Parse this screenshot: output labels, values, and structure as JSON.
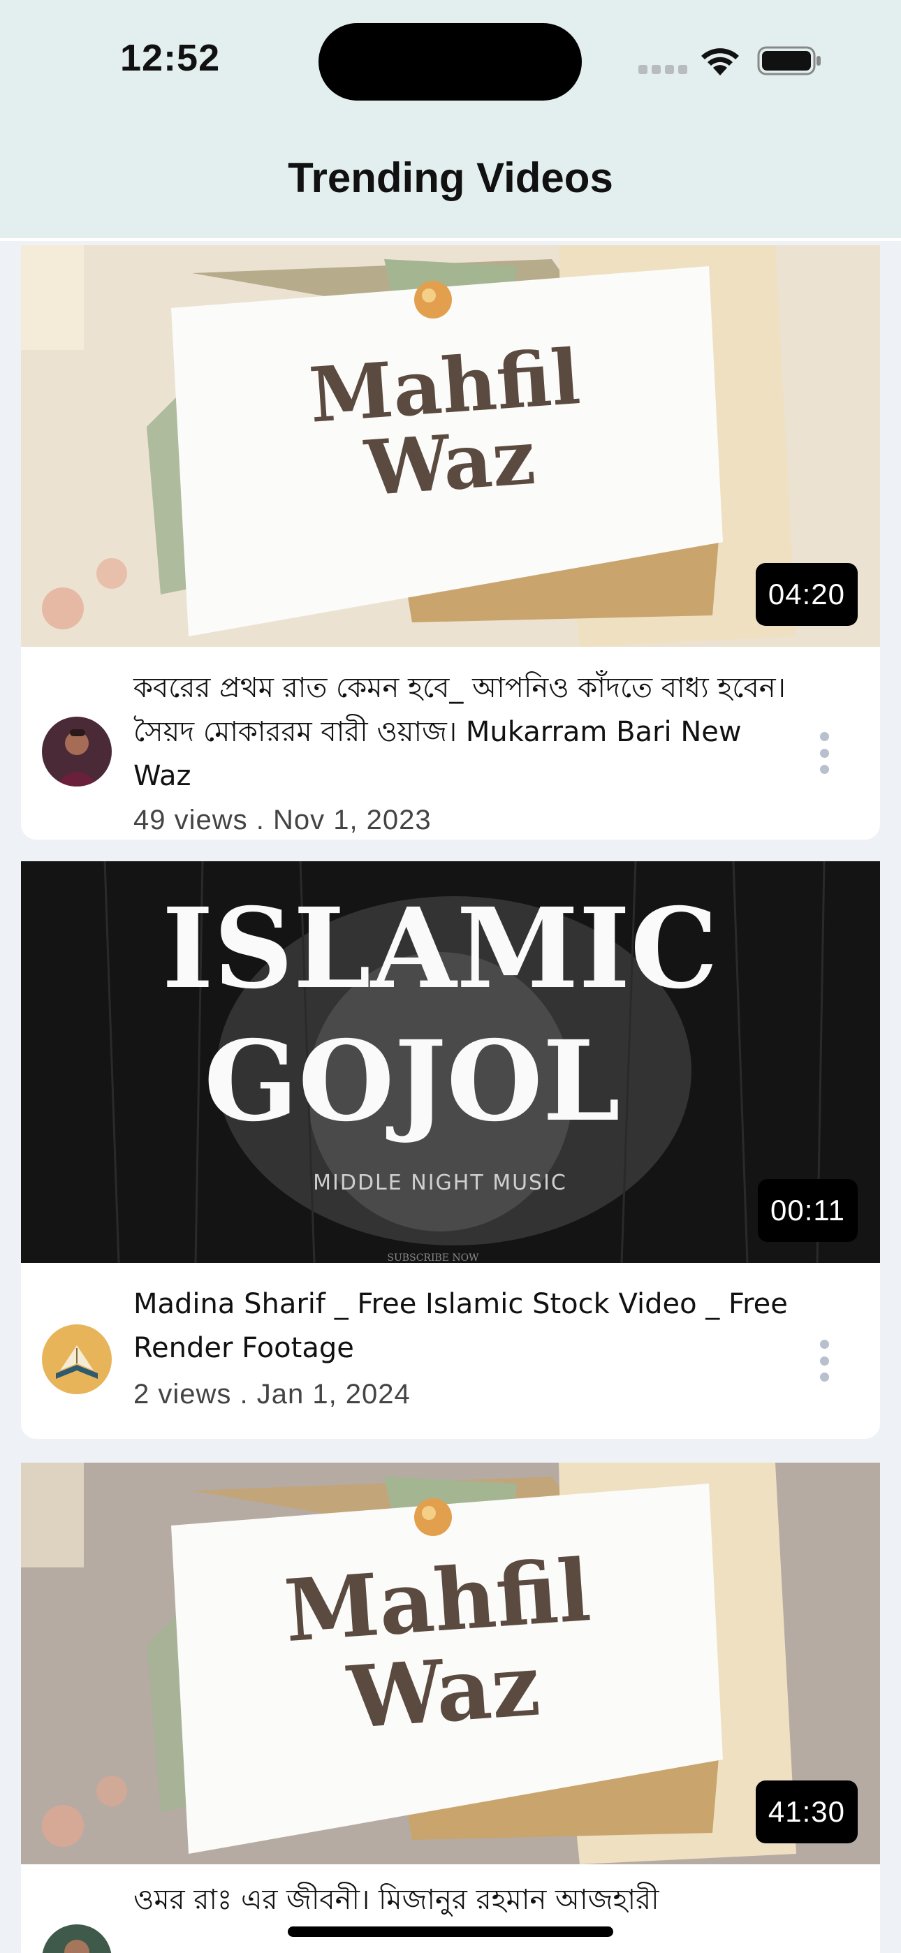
{
  "status_bar": {
    "time": "12:52"
  },
  "header": {
    "title": "Trending Videos"
  },
  "videos": [
    {
      "thumbnail_line1": "Mahfil",
      "thumbnail_line2": "Waz",
      "duration": "04:20",
      "title": "কবরের প্রথম রাত কেমন হবে_ আপনিও কাঁদতে বাধ্য হবেন। সৈয়দ মোকাররম বারী ওয়াজ। Mukarram Bari New Waz",
      "stats": "49 views . Nov 1, 2023"
    },
    {
      "thumbnail_line1": "ISLAMIC",
      "thumbnail_line2": "GOJOL",
      "thumbnail_subtitle": "MIDDLE NIGHT MUSIC",
      "thumbnail_footer": "SUBSCRIBE NOW",
      "duration": "00:11",
      "title": "Madina Sharif _ Free Islamic Stock Video _ Free Render Footage",
      "stats": "2 views . Jan 1, 2024"
    },
    {
      "thumbnail_line1": "Mahfil",
      "thumbnail_line2": "Waz",
      "duration": "41:30",
      "title": "ওমর রাঃ এর জীবনী। মিজানুর রহমান আজহারী"
    }
  ],
  "icons": {
    "more": "more-vertical-icon",
    "wifi": "wifi-icon",
    "battery": "battery-icon",
    "signal": "cellular-signal-icon"
  },
  "colors": {
    "header_bg": "#e3efef",
    "page_bg": "#eef2f6",
    "duration_badge": "#000000"
  }
}
